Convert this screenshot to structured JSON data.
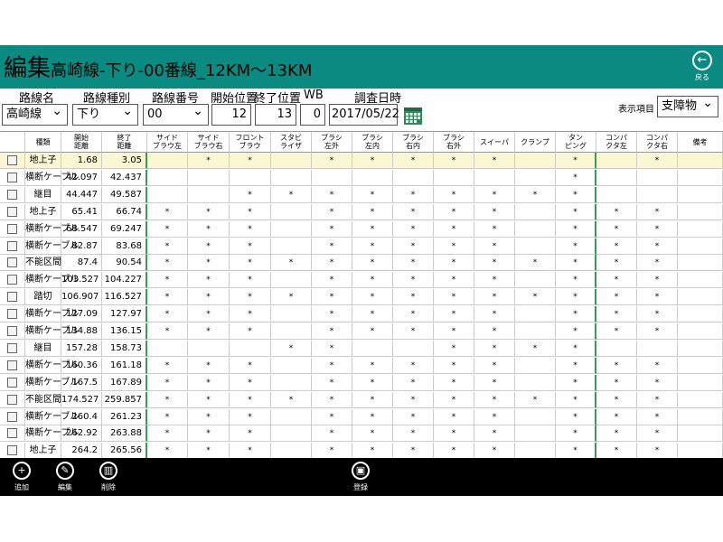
{
  "header": {
    "title_big": "編集",
    "title_rest": "高崎線-下り-00番線_12KM～13KM",
    "back_label": "戻る",
    "back_icon": "arrow-left-icon",
    "bg_color": "#0a8a80"
  },
  "filters": {
    "route_name_label": "路線名",
    "route_name_value": "高崎線",
    "route_type_label": "路線種別",
    "route_type_value": "下り",
    "route_number_label": "路線番号",
    "route_number_value": "00",
    "start_label": "開始位置",
    "start_value": "12",
    "end_label": "終了位置",
    "end_value": "13",
    "wb_label": "WB",
    "wb_value": "0",
    "date_label": "調査日時",
    "date_value": "2017/05/22",
    "display_label": "表示項目",
    "display_value": "支障物"
  },
  "table": {
    "headers": [
      "種類",
      "開始\n距離",
      "終了\n距離",
      "サイド\nブラウ左",
      "サイド\nブラウ右",
      "フロント\nブラウ",
      "スタビ\nライザ",
      "ブラシ\n左外",
      "ブラシ\n左内",
      "ブラシ\n右内",
      "ブラシ\n右外",
      "スイーパ",
      "クランプ",
      "タン\nピング",
      "コンパ\nクタ左",
      "コンパ\nクタ右",
      "備考"
    ],
    "rows": [
      {
        "type": "地上子",
        "start": "1.68",
        "end": "3.05",
        "marks": [
          "",
          "*",
          "*",
          "",
          "*",
          "*",
          "*",
          "*",
          "*",
          "",
          "*",
          "",
          "*"
        ],
        "selected": true
      },
      {
        "type": "横断ケーブル",
        "start": "42.097",
        "end": "42.437",
        "marks": [
          "",
          "",
          "",
          "",
          "",
          "",
          "",
          "",
          "",
          "",
          "*",
          "",
          ""
        ]
      },
      {
        "type": "継目",
        "start": "44.447",
        "end": "49.587",
        "marks": [
          "",
          "",
          "*",
          "*",
          "*",
          "*",
          "*",
          "*",
          "*",
          "*",
          "*",
          "",
          ""
        ]
      },
      {
        "type": "地上子",
        "start": "65.41",
        "end": "66.74",
        "marks": [
          "*",
          "*",
          "*",
          "",
          "*",
          "*",
          "*",
          "*",
          "*",
          "",
          "*",
          "*",
          "*"
        ]
      },
      {
        "type": "横断ケーブル",
        "start": "68.547",
        "end": "69.247",
        "marks": [
          "*",
          "*",
          "*",
          "",
          "*",
          "*",
          "*",
          "*",
          "*",
          "",
          "*",
          "*",
          "*"
        ]
      },
      {
        "type": "横断ケーブル",
        "start": "82.87",
        "end": "83.68",
        "marks": [
          "*",
          "*",
          "*",
          "",
          "*",
          "*",
          "*",
          "*",
          "*",
          "",
          "*",
          "*",
          "*"
        ]
      },
      {
        "type": "不能区間",
        "start": "87.4",
        "end": "90.54",
        "marks": [
          "*",
          "*",
          "*",
          "*",
          "*",
          "*",
          "*",
          "*",
          "*",
          "*",
          "*",
          "*",
          "*"
        ]
      },
      {
        "type": "横断ケーブル",
        "start": "103.527",
        "end": "104.227",
        "marks": [
          "*",
          "*",
          "*",
          "",
          "*",
          "*",
          "*",
          "*",
          "*",
          "",
          "*",
          "*",
          "*"
        ]
      },
      {
        "type": "踏切",
        "start": "106.907",
        "end": "116.527",
        "marks": [
          "*",
          "*",
          "*",
          "*",
          "*",
          "*",
          "*",
          "*",
          "*",
          "*",
          "*",
          "*",
          "*"
        ]
      },
      {
        "type": "横断ケーブル",
        "start": "127.09",
        "end": "127.97",
        "marks": [
          "*",
          "*",
          "*",
          "",
          "*",
          "*",
          "*",
          "*",
          "*",
          "",
          "*",
          "*",
          "*"
        ]
      },
      {
        "type": "横断ケーブル",
        "start": "134.88",
        "end": "136.15",
        "marks": [
          "*",
          "*",
          "*",
          "",
          "*",
          "*",
          "*",
          "*",
          "*",
          "",
          "*",
          "*",
          "*"
        ]
      },
      {
        "type": "継目",
        "start": "157.28",
        "end": "158.73",
        "marks": [
          "",
          "",
          "",
          "*",
          "*",
          "",
          "",
          "*",
          "*",
          "*",
          "*",
          "",
          ""
        ]
      },
      {
        "type": "横断ケーブル",
        "start": "160.36",
        "end": "161.18",
        "marks": [
          "*",
          "*",
          "*",
          "",
          "*",
          "*",
          "*",
          "*",
          "*",
          "",
          "*",
          "*",
          "*"
        ]
      },
      {
        "type": "横断ケーブル",
        "start": "167.5",
        "end": "167.89",
        "marks": [
          "*",
          "*",
          "*",
          "",
          "*",
          "*",
          "*",
          "*",
          "*",
          "",
          "*",
          "*",
          "*"
        ]
      },
      {
        "type": "不能区間",
        "start": "174.527",
        "end": "259.857",
        "marks": [
          "*",
          "*",
          "*",
          "*",
          "*",
          "*",
          "*",
          "*",
          "*",
          "*",
          "*",
          "*",
          "*"
        ]
      },
      {
        "type": "横断ケーブル",
        "start": "260.4",
        "end": "261.23",
        "marks": [
          "*",
          "*",
          "*",
          "",
          "*",
          "*",
          "*",
          "*",
          "*",
          "",
          "*",
          "*",
          "*"
        ]
      },
      {
        "type": "横断ケーブル",
        "start": "262.92",
        "end": "263.88",
        "marks": [
          "*",
          "*",
          "*",
          "",
          "*",
          "*",
          "*",
          "*",
          "*",
          "",
          "*",
          "*",
          "*"
        ]
      },
      {
        "type": "地上子",
        "start": "264.2",
        "end": "265.56",
        "marks": [
          "*",
          "*",
          "*",
          "",
          "*",
          "*",
          "*",
          "*",
          "*",
          "",
          "*",
          "*",
          "*"
        ]
      }
    ]
  },
  "appbar": {
    "add_label": "追加",
    "add_icon": "plus-icon",
    "edit_label": "編集",
    "edit_icon": "pencil-icon",
    "delete_label": "削除",
    "delete_icon": "trash-icon",
    "register_label": "登録",
    "register_icon": "save-icon"
  }
}
